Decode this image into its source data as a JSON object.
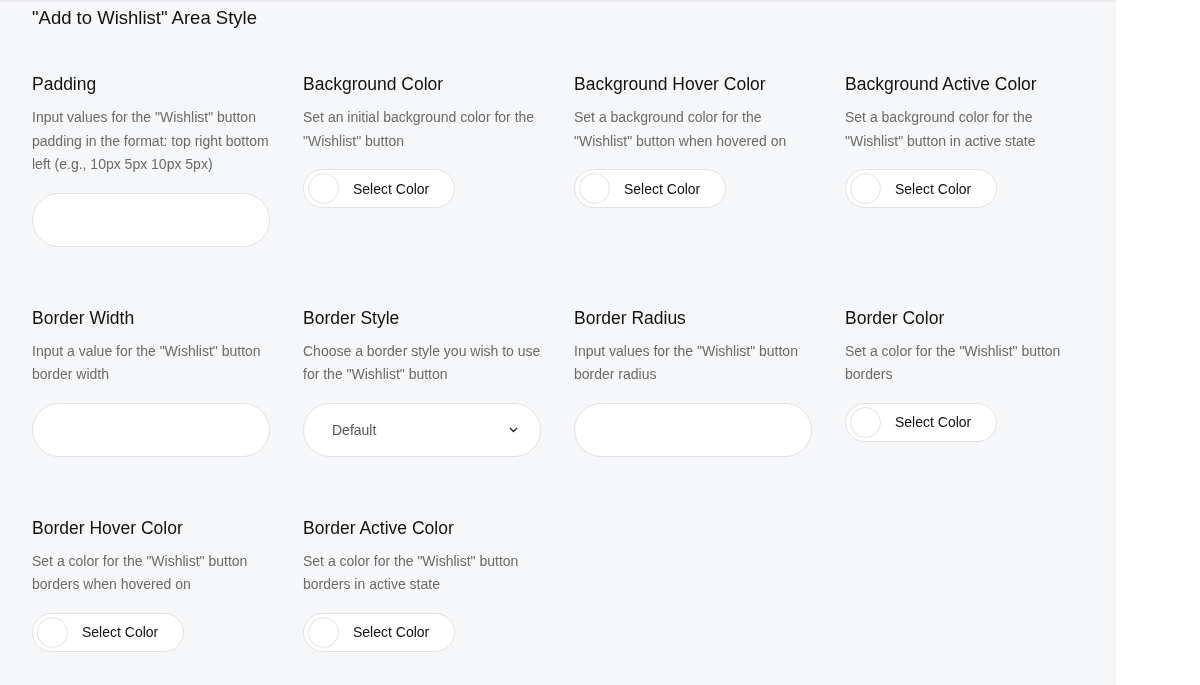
{
  "section": {
    "title": "\"Add to Wishlist\" Area Style"
  },
  "settings": [
    {
      "label": "Padding",
      "description": "Input values for the \"Wishlist\" button padding in the format: top right bottom left (e.g., 10px 5px 10px 5px)",
      "kind": "text"
    },
    {
      "label": "Background Color",
      "description": "Set an initial background color for the \"Wishlist\" button",
      "kind": "color",
      "button": "Select Color"
    },
    {
      "label": "Background Hover Color",
      "description": "Set a background color for the \"Wishlist\" button when hovered on",
      "kind": "color",
      "button": "Select Color"
    },
    {
      "label": "Background Active Color",
      "description": "Set a background color for the \"Wishlist\" button in active state",
      "kind": "color",
      "button": "Select Color"
    },
    {
      "label": "Border Width",
      "description": "Input a value for the \"Wishlist\" button border width",
      "kind": "text"
    },
    {
      "label": "Border Style",
      "description": "Choose a border style you wish to use for the \"Wishlist\" button",
      "kind": "select",
      "value": "Default"
    },
    {
      "label": "Border Radius",
      "description": "Input values for the \"Wishlist\" button border radius",
      "kind": "text"
    },
    {
      "label": "Border Color",
      "description": "Set a color for the \"Wishlist\" button borders",
      "kind": "color",
      "button": "Select Color"
    },
    {
      "label": "Border Hover Color",
      "description": "Set a color for the \"Wishlist\" button borders when hovered on",
      "kind": "color",
      "button": "Select Color"
    },
    {
      "label": "Border Active Color",
      "description": "Set a color for the \"Wishlist\" button borders in active state",
      "kind": "color",
      "button": "Select Color"
    }
  ]
}
